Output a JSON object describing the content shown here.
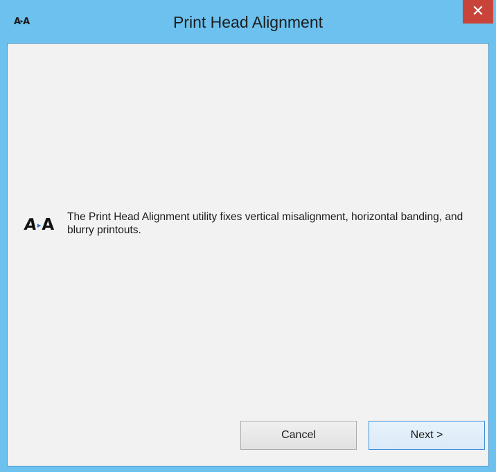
{
  "window": {
    "title": "Print Head Alignment",
    "app_icon": "aa-alignment-icon",
    "close_label": "✕",
    "colors": {
      "titlebar": "#6cc1ef",
      "close_button": "#c8443a",
      "client_background": "#f2f2f2"
    }
  },
  "main": {
    "info_icon": "aa-alignment-icon",
    "info_icon_left": "A",
    "info_icon_arrow": "▸",
    "info_icon_right": "A",
    "description": "The Print Head Alignment utility fixes vertical misalignment, horizontal banding, and blurry printouts."
  },
  "buttons": {
    "cancel_label": "Cancel",
    "next_label": "Next >"
  }
}
